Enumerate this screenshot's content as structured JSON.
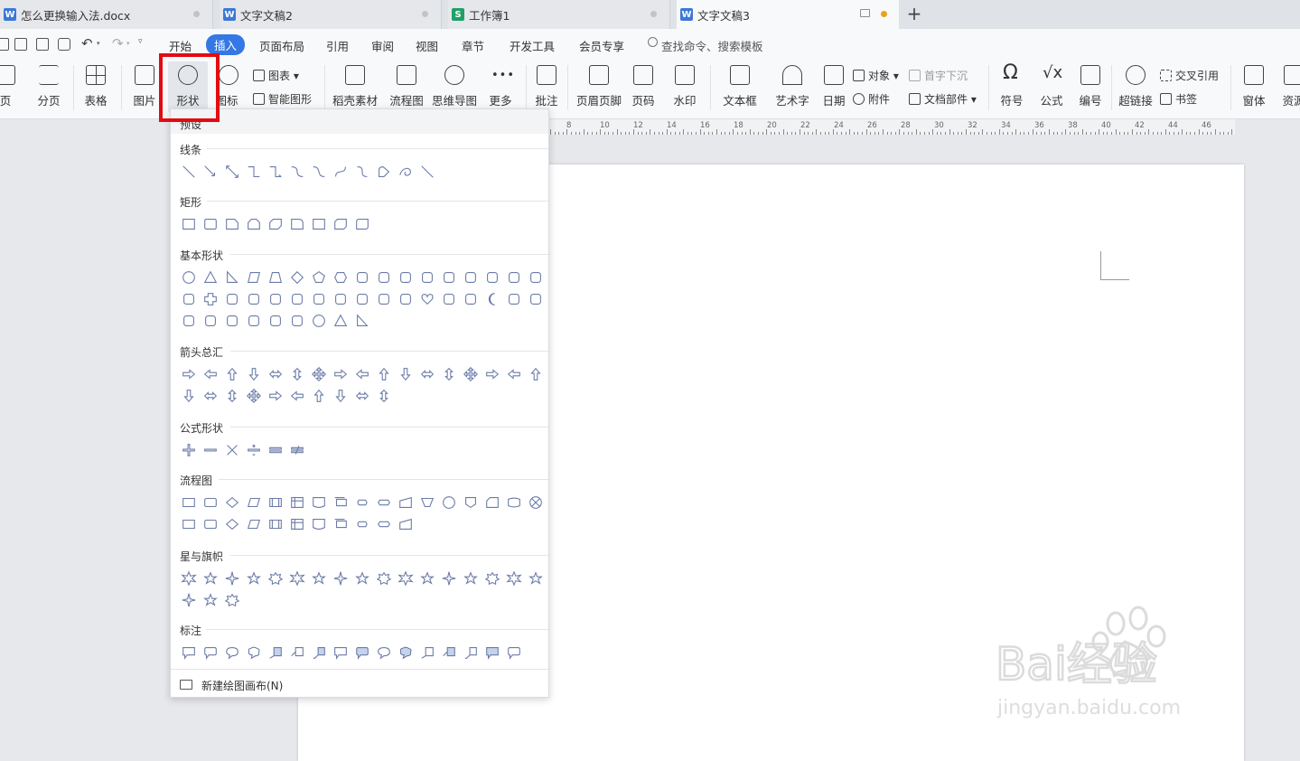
{
  "tabs": [
    {
      "label": "怎么更换输入法.docx",
      "type": "W",
      "color": "#3b78d8"
    },
    {
      "label": "文字文稿2",
      "type": "W",
      "color": "#3b78d8"
    },
    {
      "label": "工作簿1",
      "type": "S",
      "color": "#1fa067"
    },
    {
      "label": "文字文稿3",
      "type": "W",
      "color": "#3b78d8"
    }
  ],
  "menu": {
    "items": [
      "开始",
      "插入",
      "页面布局",
      "引用",
      "审阅",
      "视图",
      "章节",
      "开发工具",
      "会员专享"
    ],
    "active": "插入",
    "search": "查找命令、搜索模板"
  },
  "ribbon": {
    "page": "页",
    "page_break": "分页",
    "table": "表格",
    "picture": "图片",
    "shape": "形状",
    "icon": "图标",
    "chart": "图表",
    "smart_graphic": "智能图形",
    "docer": "稻壳素材",
    "flowchart": "流程图",
    "mindmap": "思维导图",
    "more": "更多",
    "comment": "批注",
    "header_footer": "页眉页脚",
    "page_number": "页码",
    "watermark": "水印",
    "textbox": "文本框",
    "wordart": "艺术字",
    "date": "日期",
    "object": "对象",
    "attachment": "附件",
    "drop_cap": "首字下沉",
    "doc_parts": "文档部件",
    "symbol": "符号",
    "formula": "公式",
    "numbering": "编号",
    "hyperlink": "超链接",
    "cross_ref": "交叉引用",
    "bookmark": "书签",
    "window": "窗体",
    "resource": "资源"
  },
  "ruler": [
    "8",
    "10",
    "12",
    "14",
    "16",
    "18",
    "20",
    "22",
    "24",
    "26",
    "28",
    "30",
    "32",
    "34",
    "36",
    "38",
    "40",
    "42",
    "44",
    "46"
  ],
  "dropdown": {
    "top": "预设",
    "categories": [
      "线条",
      "矩形",
      "基本形状",
      "箭头总汇",
      "公式形状",
      "流程图",
      "星与旗帜",
      "标注"
    ],
    "footer": "新建绘图画布(N)"
  },
  "watermark": {
    "brand": "Bai经验",
    "url": "jingyan.baidu.com"
  },
  "colors": {
    "accent": "#3578e5",
    "highlight": "#e30b12",
    "shape_stroke": "#6b7ba8"
  }
}
